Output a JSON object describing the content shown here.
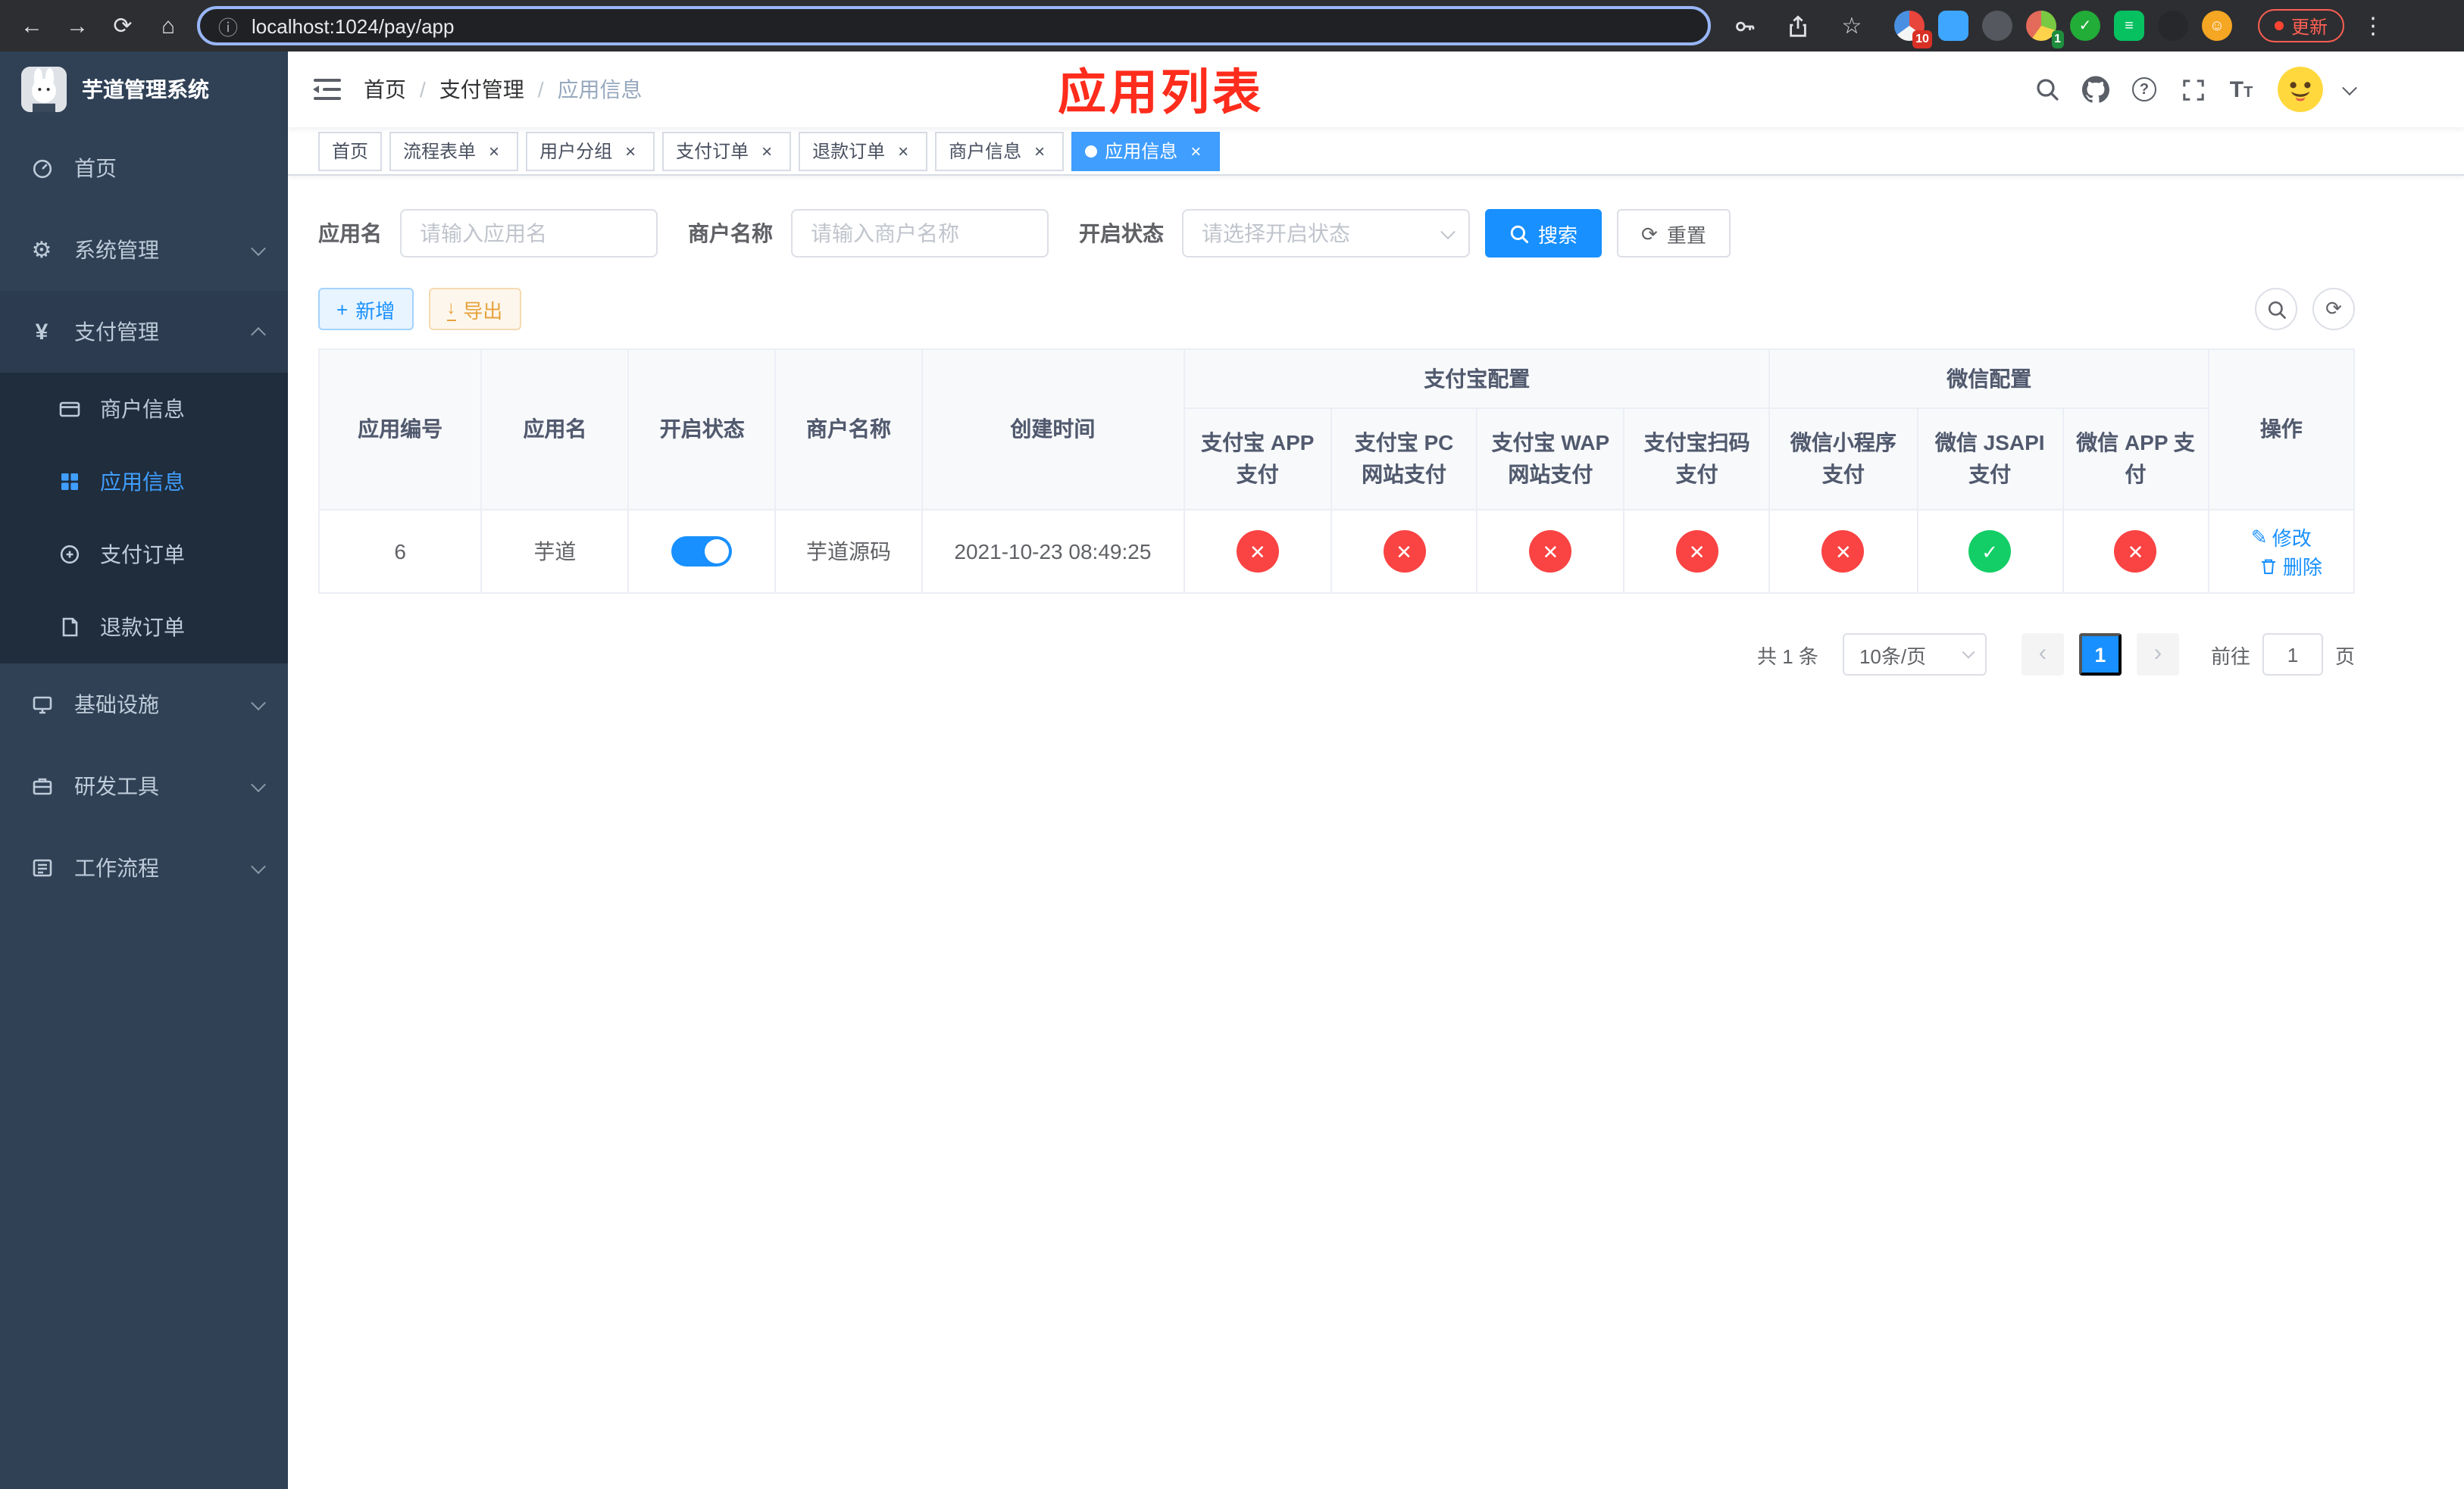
{
  "theme": {
    "primary_blue": "#1890ff",
    "tag_active_blue": "#409eff",
    "danger_red": "#fa4343",
    "success_green": "#13ce66",
    "warning_orange": "#e6a23c",
    "sidebar_bg": "#304156",
    "sidebar_submenu_bg": "#1f2d3d",
    "annotation_red": "#fe2c1c"
  },
  "browser": {
    "url": "localhost:1024/pay/app",
    "update_label": "更新",
    "extension_badge_10": "10",
    "extension_badge_1": "1"
  },
  "sidebar": {
    "title": "芋道管理系统",
    "items": [
      {
        "label": "首页"
      },
      {
        "label": "系统管理"
      },
      {
        "label": "支付管理"
      },
      {
        "label": "基础设施"
      },
      {
        "label": "研发工具"
      },
      {
        "label": "工作流程"
      }
    ],
    "payment_children": [
      {
        "label": "商户信息"
      },
      {
        "label": "应用信息"
      },
      {
        "label": "支付订单"
      },
      {
        "label": "退款订单"
      }
    ]
  },
  "header": {
    "breadcrumb": [
      "首页",
      "支付管理",
      "应用信息"
    ],
    "breadcrumb_sep": "/",
    "annotation": "应用列表"
  },
  "tabs": [
    {
      "label": "首页"
    },
    {
      "label": "流程表单"
    },
    {
      "label": "用户分组"
    },
    {
      "label": "支付订单"
    },
    {
      "label": "退款订单"
    },
    {
      "label": "商户信息"
    },
    {
      "label": "应用信息"
    }
  ],
  "filters": {
    "app_name_label": "应用名",
    "app_name_placeholder": "请输入应用名",
    "merchant_label": "商户名称",
    "merchant_placeholder": "请输入商户名称",
    "status_label": "开启状态",
    "status_placeholder": "请选择开启状态",
    "search_label": "搜索",
    "reset_label": "重置"
  },
  "toolbar": {
    "add_label": "新增",
    "export_label": "导出"
  },
  "table": {
    "col_headers": {
      "app_id": "应用编号",
      "app_name": "应用名",
      "status": "开启状态",
      "merchant": "商户名称",
      "created": "创建时间",
      "alipay_group": "支付宝配置",
      "wechat_group": "微信配置",
      "actions": "操作",
      "sub": [
        "支付宝 APP 支付",
        "支付宝 PC 网站支付",
        "支付宝 WAP 网站支付",
        "支付宝扫码支付",
        "微信小程序支付",
        "微信 JSAPI 支付",
        "微信 APP 支付"
      ]
    },
    "rows": [
      {
        "app_id": "6",
        "app_name": "芋道",
        "status_on": true,
        "merchant": "芋道源码",
        "created": "2021-10-23 08:49:25",
        "configs": [
          false,
          false,
          false,
          false,
          false,
          true,
          false
        ],
        "edit_label": "修改",
        "delete_label": "删除"
      }
    ]
  },
  "pagination": {
    "total_text": "共 1 条",
    "page_size_text": "10条/页",
    "current_page": "1",
    "goto_label": "前往",
    "goto_value": "1",
    "page_unit_label": "页"
  },
  "icons": {
    "back": "←",
    "forward": "→",
    "reload": "⟳",
    "home": "⌂",
    "info": "ⓘ",
    "star": "☆",
    "kebab": "⋮",
    "gear": "⚙",
    "yen": "¥",
    "plus": "+",
    "download": "↓",
    "check": "✓",
    "cross": "✕",
    "edit": "✎",
    "refresh": "⟳",
    "prev": "‹",
    "next": "›",
    "close": "×"
  }
}
